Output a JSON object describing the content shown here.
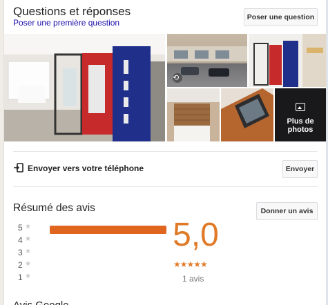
{
  "qa": {
    "title": "Questions et réponses",
    "first_question_link": "Poser une première question",
    "ask_button": "Poser une question"
  },
  "photos": {
    "more_label": "Plus de photos",
    "more_icon": "photos-icon",
    "street_icon": "street-view-icon"
  },
  "send": {
    "label": "Envoyer vers votre téléphone",
    "button": "Envoyer",
    "icon": "send-to-phone-icon"
  },
  "reviews": {
    "title": "Résumé des avis",
    "write_button": "Donner un avis",
    "rating": "5,0",
    "stars": "★★★★★",
    "count": "1 avis",
    "accent_color": "#e07a27",
    "breakdown": [
      {
        "stars": "5",
        "value": 1.0
      },
      {
        "stars": "4",
        "value": 0
      },
      {
        "stars": "3",
        "value": 0
      },
      {
        "stars": "2",
        "value": 0
      },
      {
        "stars": "1",
        "value": 0
      }
    ]
  },
  "next_section": {
    "title": "Avis Google"
  }
}
